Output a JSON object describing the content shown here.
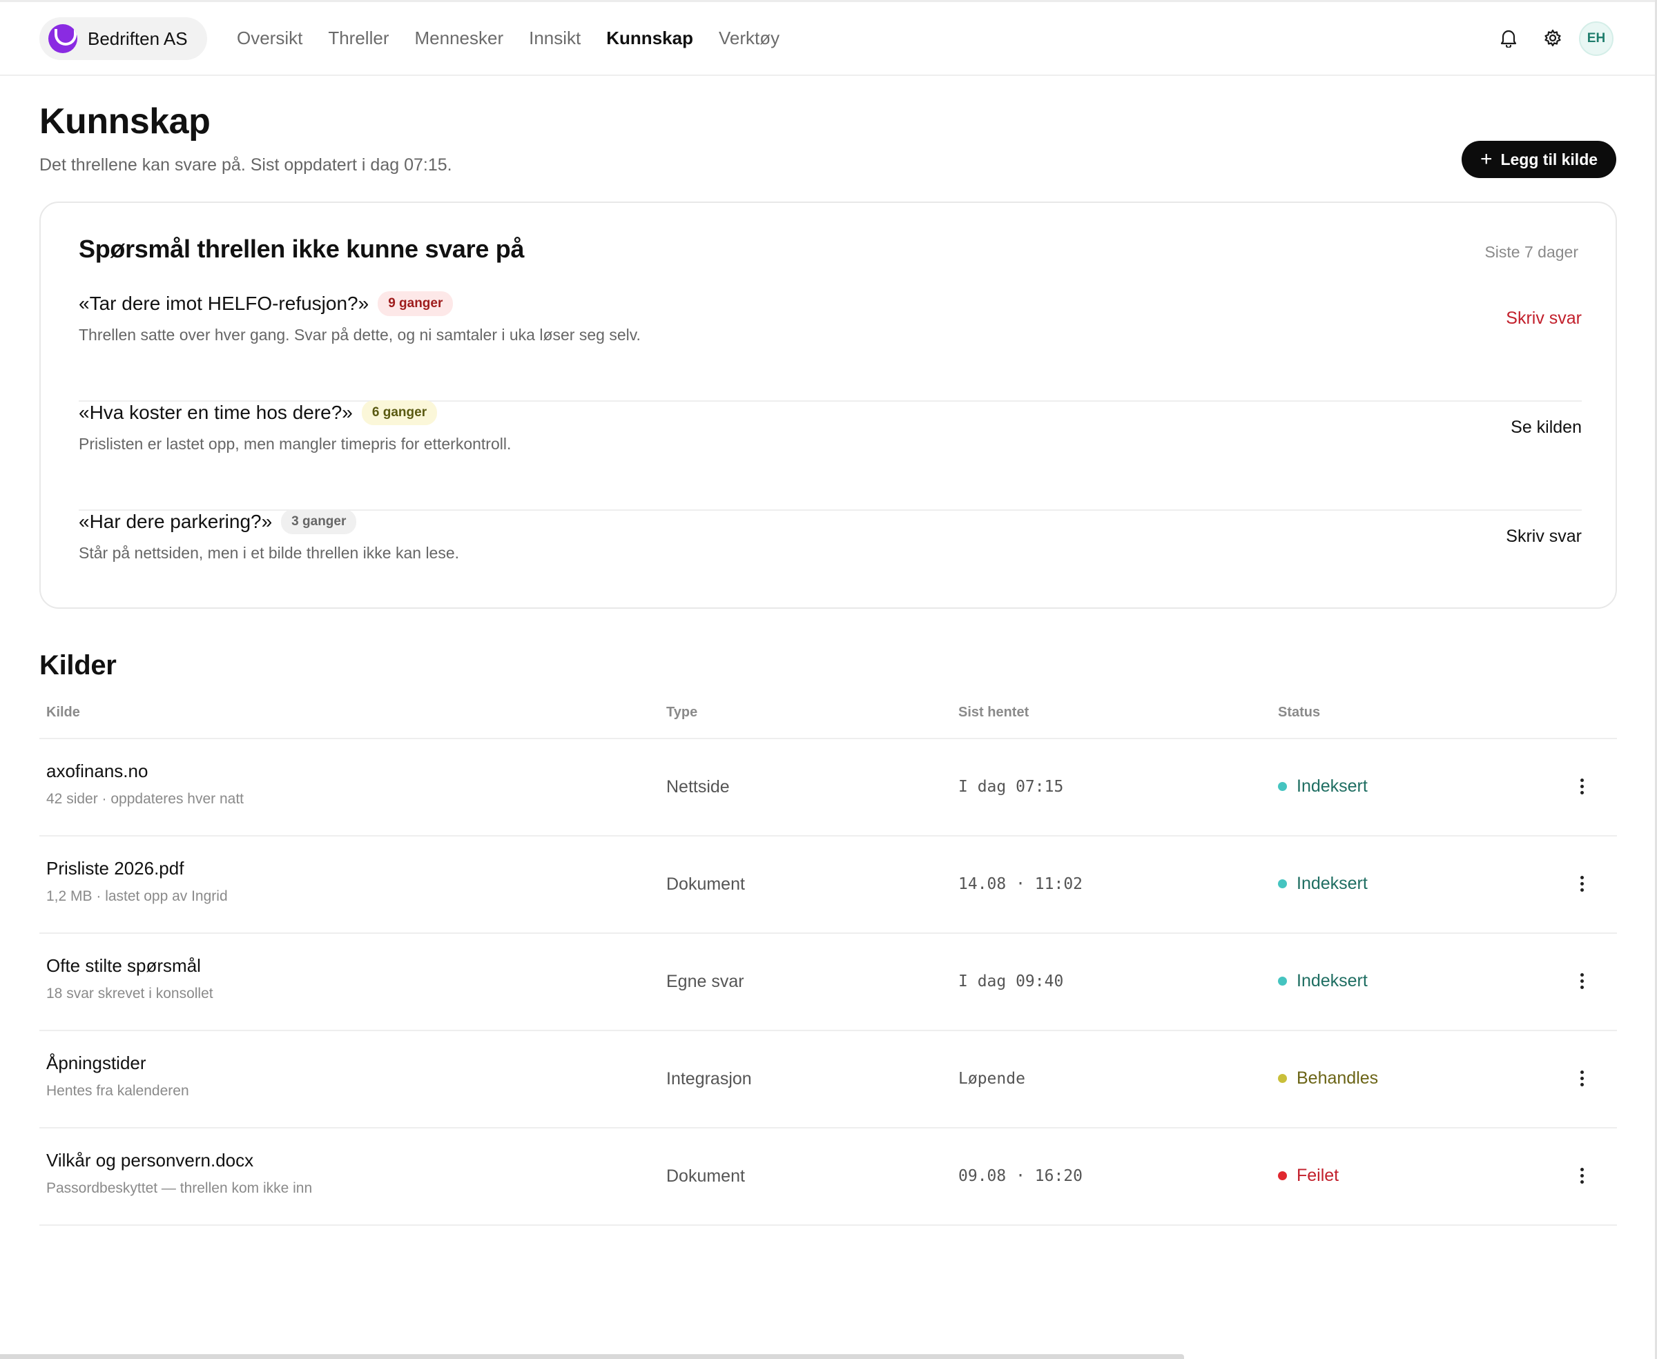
{
  "header": {
    "brand": "Bedriften AS",
    "nav": [
      "Oversikt",
      "Threller",
      "Mennesker",
      "Innsikt",
      "Kunnskap",
      "Verktøy"
    ],
    "active_nav": "Kunnskap",
    "avatar_initials": "EH",
    "icons": [
      "bell-icon",
      "gear-icon"
    ]
  },
  "page": {
    "title": "Kunnskap",
    "subtitle": "Det threllene kan svare på. Sist oppdatert i dag 07:15.",
    "add_button": "Legg til kilde"
  },
  "questions": {
    "title": "Spørsmål threllen ikke kunne svare på",
    "period": "Siste 7 dager",
    "items": [
      {
        "question": "«Tar dere imot HELFO-refusjon?»",
        "count": "9 ganger",
        "description": "Threllen satte over hver gang. Svar på dette, og ni samtaler i uka løser seg selv.",
        "action": "Skriv svar",
        "badge_color": "#fde8e8",
        "action_color": "#c21f2b"
      },
      {
        "question": "«Hva koster en time hos dere?»",
        "count": "6 ganger",
        "description": "Prislisten er lastet opp, men mangler timepris for etterkontroll.",
        "action": "Se kilden",
        "badge_color": "#fbf7d9",
        "action_color": "#111111"
      },
      {
        "question": "«Har dere parkering?»",
        "count": "3 ganger",
        "description": "Står på nettsiden, men i et bilde threllen ikke kan lese.",
        "action": "Skriv svar",
        "badge_color": "#f0f0f0",
        "action_color": "#111111"
      }
    ]
  },
  "sources": {
    "title": "Kilder",
    "columns": [
      "Kilde",
      "Type",
      "Sist hentet",
      "Status"
    ],
    "rows": [
      {
        "name": "axofinans.no",
        "meta": "42 sider · oppdateres hver natt",
        "type": "Nettside",
        "fetched": "I dag 07:15",
        "status": "Indeksert",
        "status_color": "#45c4c0",
        "status_text_color": "#1f6e62"
      },
      {
        "name": "Prisliste 2026.pdf",
        "meta": "1,2 MB · lastet opp av Ingrid",
        "type": "Dokument",
        "fetched": "14.08 · 11:02",
        "status": "Indeksert",
        "status_color": "#45c4c0",
        "status_text_color": "#1f6e62"
      },
      {
        "name": "Ofte stilte spørsmål",
        "meta": "18 svar skrevet i konsollet",
        "type": "Egne svar",
        "fetched": "I dag 09:40",
        "status": "Indeksert",
        "status_color": "#45c4c0",
        "status_text_color": "#1f6e62"
      },
      {
        "name": "Åpningstider",
        "meta": "Hentes fra kalenderen",
        "type": "Integrasjon",
        "fetched": "Løpende",
        "status": "Behandles",
        "status_color": "#c9bf3a",
        "status_text_color": "#6b6416"
      },
      {
        "name": "Vilkår og personvern.docx",
        "meta": "Passordbeskyttet — threllen kom ikke inn",
        "type": "Dokument",
        "fetched": "09.08 · 16:20",
        "status": "Feilet",
        "status_color": "#e0282f",
        "status_text_color": "#c21f2b"
      }
    ]
  },
  "colors": {
    "brand": "#8a2be2",
    "primary_button": "#0c0c0c",
    "danger": "#c21f2b"
  }
}
